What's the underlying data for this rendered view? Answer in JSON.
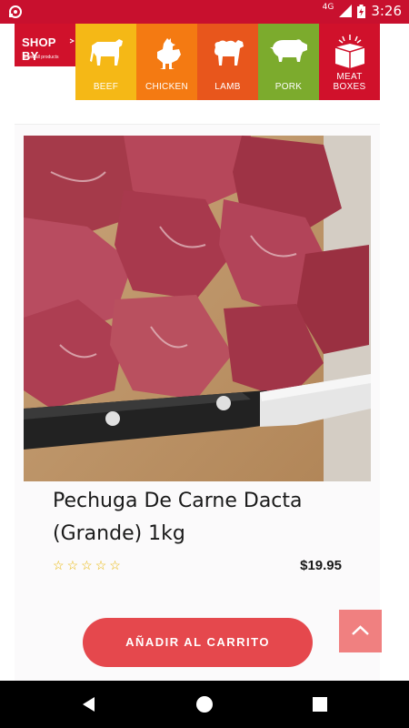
{
  "status_bar": {
    "network": "4G",
    "time": "3:26"
  },
  "category_bar": {
    "shop_by": {
      "title": "SHOP BY",
      "subtitle": "Show all products"
    },
    "categories": [
      {
        "label": "BEEF",
        "icon": "cow-icon",
        "color": "#f5b816"
      },
      {
        "label": "CHICKEN",
        "icon": "chicken-icon",
        "color": "#f47a12"
      },
      {
        "label": "LAMB",
        "icon": "lamb-icon",
        "color": "#e8561c"
      },
      {
        "label": "PORK",
        "icon": "pig-icon",
        "color": "#7cab2d"
      },
      {
        "label": "MEAT BOXES",
        "icon": "box-icon",
        "color": "#d0112b"
      }
    ]
  },
  "product": {
    "title": "Pechuga De Carne Dacta (Grande) 1kg",
    "price": "$19.95",
    "rating": 0,
    "rating_max": 5,
    "add_to_cart_label": "AÑADIR AL CARRITO"
  },
  "colors": {
    "status_bar": "#c8102e",
    "button": "#e5484d",
    "scroll_top": "#f08080",
    "stars": "#e8b400"
  }
}
